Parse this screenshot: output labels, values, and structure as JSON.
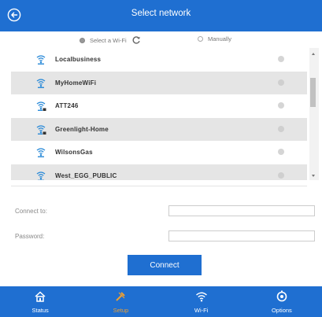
{
  "header": {
    "title": "Select network"
  },
  "mode": {
    "wifi_label": "Select a Wi-Fi",
    "manual_label": "Manually",
    "selected": "wifi"
  },
  "networks": [
    {
      "ssid": "Localbusiness",
      "signal_icon": "wifi-icon",
      "locked": false
    },
    {
      "ssid": "MyHomeWiFi",
      "signal_icon": "wifi-icon",
      "locked": false
    },
    {
      "ssid": "ATT246",
      "signal_icon": "wifi-lock-icon",
      "locked": true
    },
    {
      "ssid": "Greenlight-Home",
      "signal_icon": "wifi-lock-icon",
      "locked": true
    },
    {
      "ssid": "WilsonsGas",
      "signal_icon": "wifi-icon",
      "locked": false
    },
    {
      "ssid": "West_EGG_PUBLIC",
      "signal_icon": "wifi-icon",
      "locked": false
    }
  ],
  "form": {
    "connect_to_label": "Connect to:",
    "connect_to_value": "",
    "password_label": "Password:",
    "password_value": "",
    "connect_button": "Connect"
  },
  "footer": {
    "tabs": [
      {
        "label": "Status",
        "icon": "home-icon",
        "active": false
      },
      {
        "label": "Setup",
        "icon": "tools-icon",
        "active": true
      },
      {
        "label": "Wi-Fi",
        "icon": "wifi-icon",
        "active": false
      },
      {
        "label": "Options",
        "icon": "gear-icon",
        "active": false
      }
    ]
  },
  "colors": {
    "primary": "#1f6fd1",
    "active_tab": "#f0a030",
    "row_alt": "#e5e5e5"
  }
}
